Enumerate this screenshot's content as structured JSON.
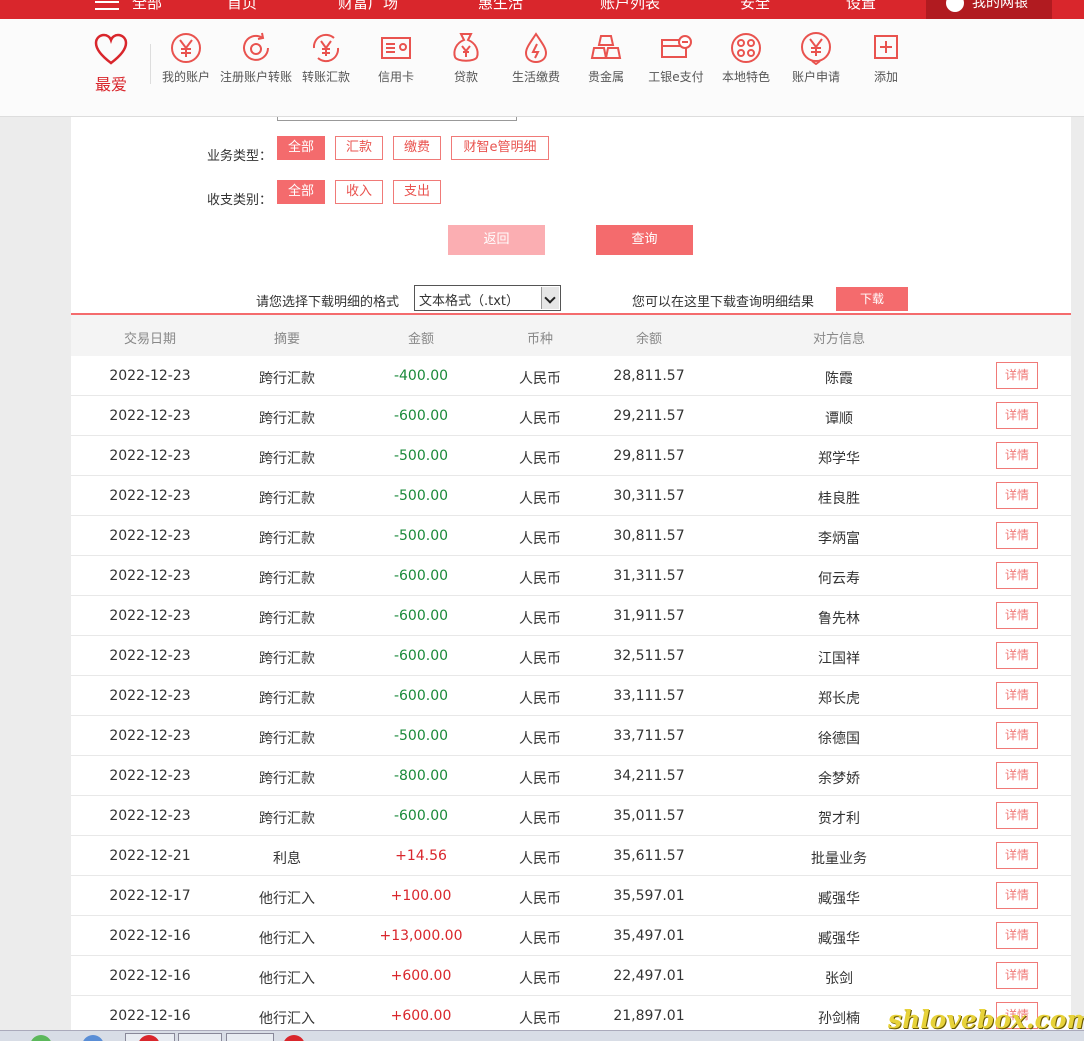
{
  "topnav": {
    "items": [
      "全部",
      "首页",
      "财富广场",
      "惠生活",
      "账户列表",
      "安全",
      "设置"
    ],
    "my_bank": "我的网银"
  },
  "iconbar": {
    "favorite": "最爱",
    "items": [
      {
        "label": "我的账户",
        "icon": "yen-circle-icon"
      },
      {
        "label": "注册账户转账",
        "icon": "refresh-yen-icon"
      },
      {
        "label": "转账汇款",
        "icon": "transfer-yen-icon"
      },
      {
        "label": "信用卡",
        "icon": "credit-card-icon"
      },
      {
        "label": "贷款",
        "icon": "money-bag-icon"
      },
      {
        "label": "生活缴费",
        "icon": "utility-drop-icon"
      },
      {
        "label": "贵金属",
        "icon": "gold-bars-icon"
      },
      {
        "label": "工银e支付",
        "icon": "e-pay-icon"
      },
      {
        "label": "本地特色",
        "icon": "local-dots-icon"
      },
      {
        "label": "账户申请",
        "icon": "yen-apply-icon"
      },
      {
        "label": "添加",
        "icon": "plus-square-icon"
      }
    ]
  },
  "filters": {
    "business_type_label": "业务类型：",
    "business_types": [
      "全部",
      "汇款",
      "缴费",
      "财智e管明细"
    ],
    "income_type_label": "收支类别：",
    "income_types": [
      "全部",
      "收入",
      "支出"
    ],
    "back_button": "返回",
    "query_button": "查询"
  },
  "download": {
    "format_label": "请您选择下载明细的格式",
    "format_value": "文本格式（.txt）",
    "hint": "您可以在这里下载查询明细结果",
    "button": "下载"
  },
  "table": {
    "headers": [
      "交易日期",
      "摘要",
      "金额",
      "币种",
      "余额",
      "对方信息"
    ],
    "detail_label": "详情",
    "rows": [
      {
        "date": "2022-12-23",
        "summary": "跨行汇款",
        "amount": "-400.00",
        "sign": "neg",
        "currency": "人民币",
        "balance": "28,811.57",
        "party": "陈霞"
      },
      {
        "date": "2022-12-23",
        "summary": "跨行汇款",
        "amount": "-600.00",
        "sign": "neg",
        "currency": "人民币",
        "balance": "29,211.57",
        "party": "谭顺"
      },
      {
        "date": "2022-12-23",
        "summary": "跨行汇款",
        "amount": "-500.00",
        "sign": "neg",
        "currency": "人民币",
        "balance": "29,811.57",
        "party": "郑学华"
      },
      {
        "date": "2022-12-23",
        "summary": "跨行汇款",
        "amount": "-500.00",
        "sign": "neg",
        "currency": "人民币",
        "balance": "30,311.57",
        "party": "桂良胜"
      },
      {
        "date": "2022-12-23",
        "summary": "跨行汇款",
        "amount": "-500.00",
        "sign": "neg",
        "currency": "人民币",
        "balance": "30,811.57",
        "party": "李炳富"
      },
      {
        "date": "2022-12-23",
        "summary": "跨行汇款",
        "amount": "-600.00",
        "sign": "neg",
        "currency": "人民币",
        "balance": "31,311.57",
        "party": "何云寿"
      },
      {
        "date": "2022-12-23",
        "summary": "跨行汇款",
        "amount": "-600.00",
        "sign": "neg",
        "currency": "人民币",
        "balance": "31,911.57",
        "party": "鲁先林"
      },
      {
        "date": "2022-12-23",
        "summary": "跨行汇款",
        "amount": "-600.00",
        "sign": "neg",
        "currency": "人民币",
        "balance": "32,511.57",
        "party": "江国祥"
      },
      {
        "date": "2022-12-23",
        "summary": "跨行汇款",
        "amount": "-600.00",
        "sign": "neg",
        "currency": "人民币",
        "balance": "33,111.57",
        "party": "郑长虎"
      },
      {
        "date": "2022-12-23",
        "summary": "跨行汇款",
        "amount": "-500.00",
        "sign": "neg",
        "currency": "人民币",
        "balance": "33,711.57",
        "party": "徐德国"
      },
      {
        "date": "2022-12-23",
        "summary": "跨行汇款",
        "amount": "-800.00",
        "sign": "neg",
        "currency": "人民币",
        "balance": "34,211.57",
        "party": "余梦娇"
      },
      {
        "date": "2022-12-23",
        "summary": "跨行汇款",
        "amount": "-600.00",
        "sign": "neg",
        "currency": "人民币",
        "balance": "35,011.57",
        "party": "贺才利"
      },
      {
        "date": "2022-12-21",
        "summary": "利息",
        "amount": "+14.56",
        "sign": "pos",
        "currency": "人民币",
        "balance": "35,611.57",
        "party": "批量业务"
      },
      {
        "date": "2022-12-17",
        "summary": "他行汇入",
        "amount": "+100.00",
        "sign": "pos",
        "currency": "人民币",
        "balance": "35,597.01",
        "party": "臧强华"
      },
      {
        "date": "2022-12-16",
        "summary": "他行汇入",
        "amount": "+13,000.00",
        "sign": "pos",
        "currency": "人民币",
        "balance": "35,497.01",
        "party": "臧强华"
      },
      {
        "date": "2022-12-16",
        "summary": "他行汇入",
        "amount": "+600.00",
        "sign": "pos",
        "currency": "人民币",
        "balance": "22,497.01",
        "party": "张剑"
      },
      {
        "date": "2022-12-16",
        "summary": "他行汇入",
        "amount": "+600.00",
        "sign": "pos",
        "currency": "人民币",
        "balance": "21,897.01",
        "party": "孙剑楠"
      }
    ]
  },
  "watermark": "shlovebox.com",
  "colors": {
    "brand_red": "#d9262c",
    "button_pink": "#f46b6d",
    "negative": "#1a8a3a",
    "positive": "#d9262c"
  }
}
